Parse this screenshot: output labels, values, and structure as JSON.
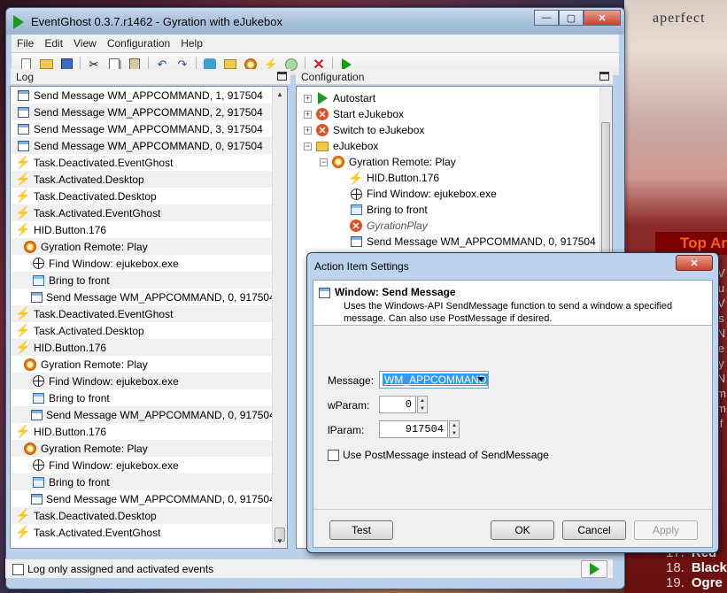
{
  "background": {
    "brand": "aperfect",
    "top_label": "Top Ar",
    "side_letters": [
      "V",
      "u",
      "V",
      "s",
      "N",
      "e",
      "y",
      "N",
      "m",
      "m",
      "f"
    ],
    "list": [
      {
        "num": "17.",
        "text": "Red"
      },
      {
        "num": "18.",
        "text": "Black"
      },
      {
        "num": "19.",
        "text": "Ogre"
      }
    ]
  },
  "window": {
    "title": "EventGhost 0.3.7.r1462 - Gyration with eJukebox",
    "controls": {
      "minimize": "—",
      "maximize": "▢",
      "close": "✕"
    }
  },
  "menu": [
    "File",
    "Edit",
    "View",
    "Configuration",
    "Help"
  ],
  "toolbar": {
    "icons": [
      "new-file-icon",
      "open-folder-icon",
      "save-icon",
      "cut-icon",
      "copy-icon",
      "paste-icon",
      "undo-icon",
      "redo-icon",
      "add-plugin-icon",
      "add-folder-icon",
      "add-macro-icon",
      "add-event-icon",
      "add-action-icon",
      "delete-icon",
      "execute-icon"
    ]
  },
  "log": {
    "title": "Log",
    "rows": [
      {
        "icon": "msg",
        "level": 0,
        "text": "Send Message WM_APPCOMMAND, 1, 917504"
      },
      {
        "icon": "msg",
        "level": 0,
        "text": "Send Message WM_APPCOMMAND, 2, 917504"
      },
      {
        "icon": "msg",
        "level": 0,
        "text": "Send Message WM_APPCOMMAND, 3, 917504"
      },
      {
        "icon": "msg",
        "level": 0,
        "text": "Send Message WM_APPCOMMAND, 0, 917504"
      },
      {
        "icon": "bolt",
        "level": 0,
        "text": "Task.Deactivated.EventGhost"
      },
      {
        "icon": "bolt",
        "level": 0,
        "text": "Task.Activated.Desktop"
      },
      {
        "icon": "bolt",
        "level": 0,
        "text": "Task.Deactivated.Desktop"
      },
      {
        "icon": "bolt",
        "level": 0,
        "text": "Task.Activated.EventGhost"
      },
      {
        "icon": "bolt",
        "level": 0,
        "text": "HID.Button.176"
      },
      {
        "icon": "gear",
        "level": 1,
        "text": "Gyration Remote: Play"
      },
      {
        "icon": "cross",
        "level": 2,
        "text": "Find Window: ejukebox.exe"
      },
      {
        "icon": "front",
        "level": 2,
        "text": "Bring to front"
      },
      {
        "icon": "msg",
        "level": 2,
        "text": "Send Message WM_APPCOMMAND, 0, 917504"
      },
      {
        "icon": "bolt",
        "level": 0,
        "text": "Task.Deactivated.EventGhost"
      },
      {
        "icon": "bolt",
        "level": 0,
        "text": "Task.Activated.Desktop"
      },
      {
        "icon": "bolt",
        "level": 0,
        "text": "HID.Button.176"
      },
      {
        "icon": "gear",
        "level": 1,
        "text": "Gyration Remote: Play"
      },
      {
        "icon": "cross",
        "level": 2,
        "text": "Find Window: ejukebox.exe"
      },
      {
        "icon": "front",
        "level": 2,
        "text": "Bring to front"
      },
      {
        "icon": "msg",
        "level": 2,
        "text": "Send Message WM_APPCOMMAND, 0, 917504"
      },
      {
        "icon": "bolt",
        "level": 0,
        "text": "HID.Button.176"
      },
      {
        "icon": "gear",
        "level": 1,
        "text": "Gyration Remote: Play"
      },
      {
        "icon": "cross",
        "level": 2,
        "text": "Find Window: ejukebox.exe"
      },
      {
        "icon": "front",
        "level": 2,
        "text": "Bring to front"
      },
      {
        "icon": "msg",
        "level": 2,
        "text": "Send Message WM_APPCOMMAND, 0, 917504"
      },
      {
        "icon": "bolt",
        "level": 0,
        "text": "Task.Deactivated.Desktop"
      },
      {
        "icon": "bolt",
        "level": 0,
        "text": "Task.Activated.EventGhost"
      }
    ],
    "log_only_label": "Log only assigned and activated events",
    "log_only_checked": false
  },
  "config": {
    "title": "Configuration",
    "tree": [
      {
        "icon": "play",
        "expander": "+",
        "text": "Autostart"
      },
      {
        "icon": "xred",
        "expander": "+",
        "text": "Start eJukebox"
      },
      {
        "icon": "xred",
        "expander": "+",
        "text": "Switch to eJukebox"
      },
      {
        "icon": "folder",
        "expander": "−",
        "text": "eJukebox"
      },
      {
        "icon": "macro",
        "expander": "−",
        "text": "Gyration Remote: Play"
      },
      {
        "icon": "bolt",
        "expander": "",
        "text": "HID.Button.176"
      },
      {
        "icon": "cross",
        "expander": "",
        "text": "Find Window: ejukebox.exe"
      },
      {
        "icon": "front",
        "expander": "",
        "text": "Bring to front"
      },
      {
        "icon": "xred",
        "expander": "",
        "text": "GyrationPlay",
        "disabled": true
      },
      {
        "icon": "msg",
        "expander": "",
        "text": "Send Message WM_APPCOMMAND, 0, 917504"
      }
    ]
  },
  "dialog": {
    "title": "Action Item Settings",
    "close": "✕",
    "header_title": "Window: Send Message",
    "header_desc": "Uses the Windows-API SendMessage function to send a window a specified message. Can also use PostMessage if desired.",
    "message_label": "Message:",
    "message_value": "WM_APPCOMMAND",
    "wparam_label": "wParam:",
    "wparam_value": "0",
    "lparam_label": "lParam:",
    "lparam_value": "917504",
    "post_label": "Use PostMessage instead of SendMessage",
    "post_checked": false,
    "buttons": {
      "test": "Test",
      "ok": "OK",
      "cancel": "Cancel",
      "apply": "Apply"
    }
  }
}
